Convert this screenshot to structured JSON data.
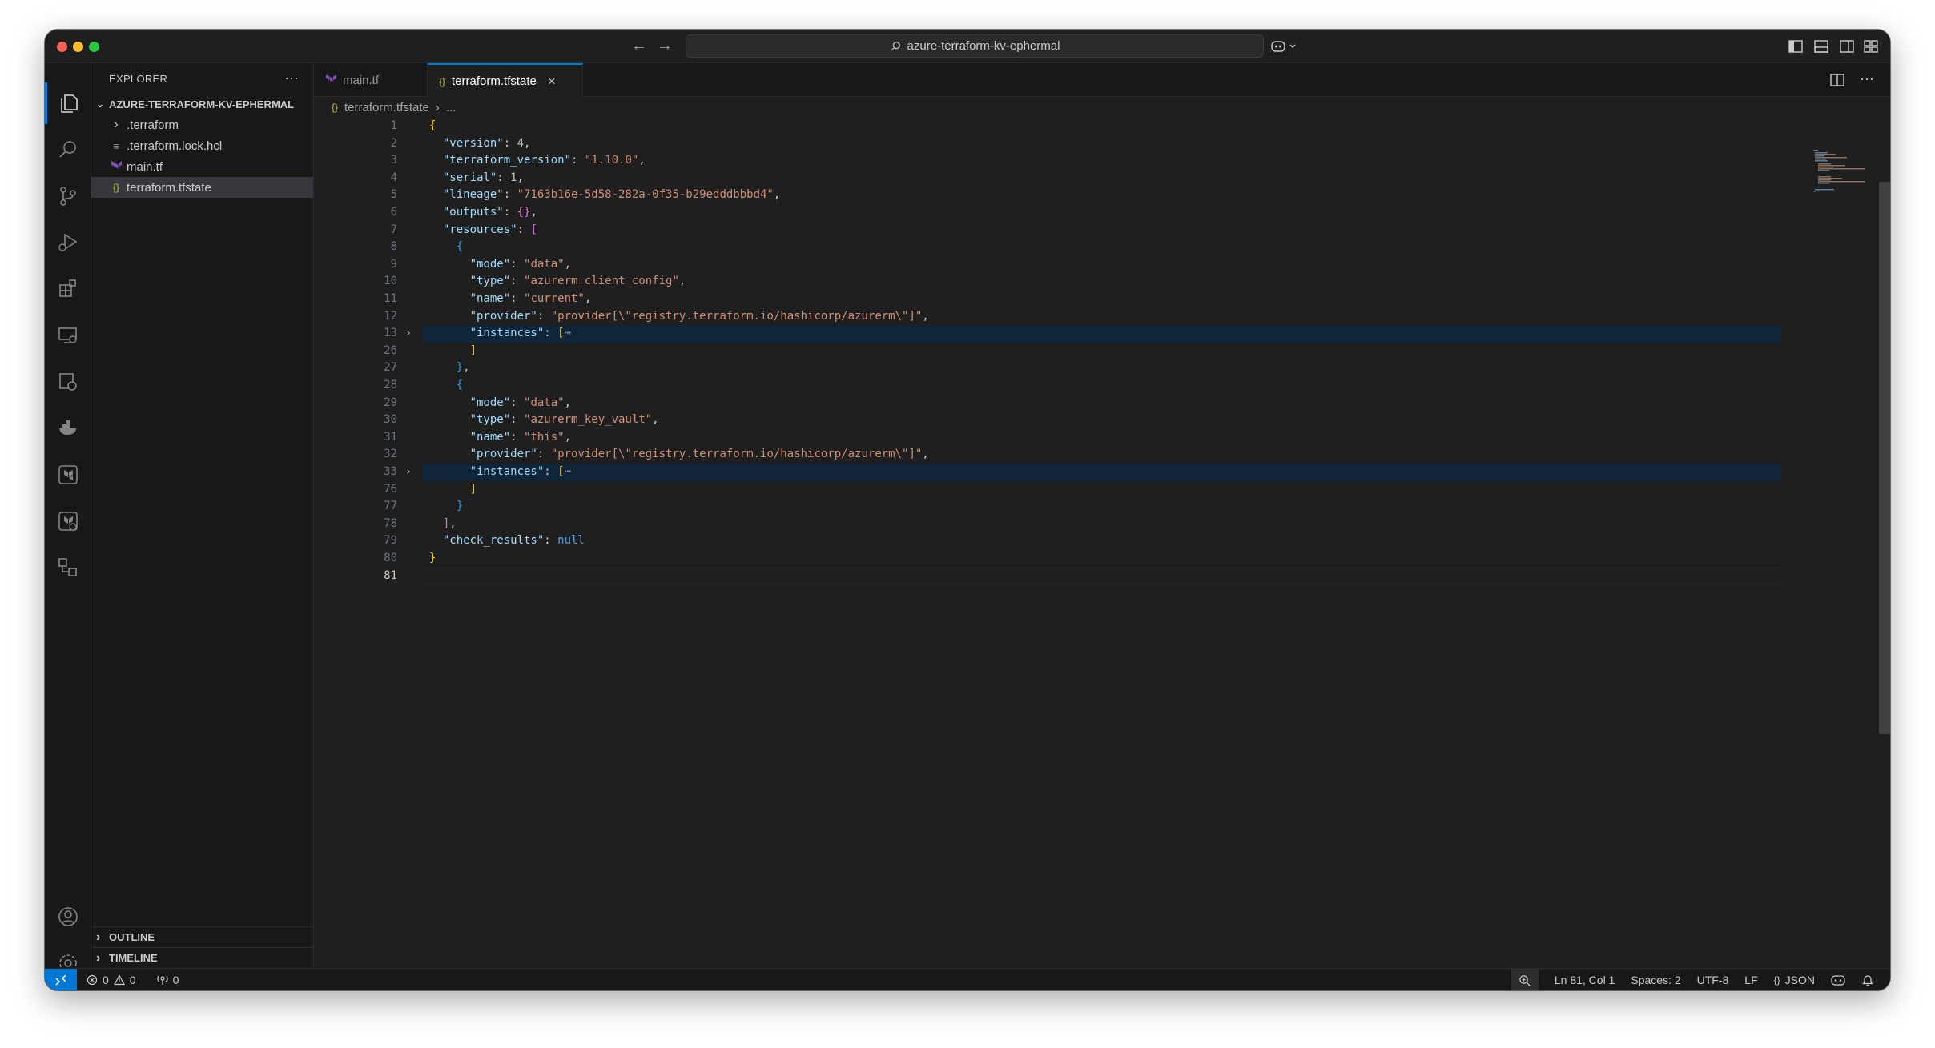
{
  "window": {
    "command_center_text": "azure-terraform-kv-ephermal"
  },
  "sidebar": {
    "title": "EXPLORER",
    "more": "···",
    "root_folder": "AZURE-TERRAFORM-KV-EPHERMAL",
    "items": [
      {
        "label": ".terraform",
        "icon": "chevron-right-icon",
        "glyph": "›"
      },
      {
        "label": ".terraform.lock.hcl",
        "icon": "list-file-icon",
        "glyph": "≡"
      },
      {
        "label": "main.tf",
        "icon": "terraform-icon",
        "glyph": ""
      },
      {
        "label": "terraform.tfstate",
        "icon": "json-braces-icon",
        "glyph": "{}"
      }
    ],
    "sections": [
      "OUTLINE",
      "TIMELINE"
    ]
  },
  "tabs": [
    {
      "label": "main.tf",
      "icon": "terraform-icon",
      "active": false
    },
    {
      "label": "terraform.tfstate",
      "icon": "json-braces-icon",
      "active": true,
      "close": "×"
    }
  ],
  "breadcrumb": {
    "file": "terraform.tfstate",
    "separator": "›",
    "more": "..."
  },
  "code": {
    "lines": [
      {
        "n": "1"
      },
      {
        "n": "2"
      },
      {
        "n": "3"
      },
      {
        "n": "4"
      },
      {
        "n": "5"
      },
      {
        "n": "6"
      },
      {
        "n": "7"
      },
      {
        "n": "8"
      },
      {
        "n": "9"
      },
      {
        "n": "10"
      },
      {
        "n": "11"
      },
      {
        "n": "12"
      },
      {
        "n": "13"
      },
      {
        "n": "26"
      },
      {
        "n": "27"
      },
      {
        "n": "28"
      },
      {
        "n": "29"
      },
      {
        "n": "30"
      },
      {
        "n": "31"
      },
      {
        "n": "32"
      },
      {
        "n": "33"
      },
      {
        "n": "76"
      },
      {
        "n": "77"
      },
      {
        "n": "78"
      },
      {
        "n": "79"
      },
      {
        "n": "80"
      },
      {
        "n": "81"
      }
    ],
    "tokens": {
      "version_key": "\"version\"",
      "version_val": "4",
      "tfver_key": "\"terraform_version\"",
      "tfver_val": "\"1.10.0\"",
      "serial_key": "\"serial\"",
      "serial_val": "1",
      "lineage_key": "\"lineage\"",
      "lineage_val": "\"7163b16e-5d58-282a-0f35-b29edddbbbd4\"",
      "outputs_key": "\"outputs\"",
      "resources_key": "\"resources\"",
      "mode_key": "\"mode\"",
      "mode_val": "\"data\"",
      "type_key": "\"type\"",
      "type_val_1": "\"azurerm_client_config\"",
      "type_val_2": "\"azurerm_key_vault\"",
      "name_key": "\"name\"",
      "name_val_1": "\"current\"",
      "name_val_2": "\"this\"",
      "provider_key": "\"provider\"",
      "provider_val": "\"provider[\\\"registry.terraform.io/hashicorp/azurerm\\\"]\"",
      "instances_key": "\"instances\"",
      "check_key": "\"check_results\"",
      "check_val": "null",
      "ellipsis": "⋯"
    }
  },
  "statusbar": {
    "remote_icon": "remote-icon",
    "errors": "0",
    "warnings": "0",
    "ports": "0",
    "position": "Ln 81, Col 1",
    "spaces": "Spaces: 2",
    "encoding": "UTF-8",
    "eol": "LF",
    "language": "JSON"
  }
}
